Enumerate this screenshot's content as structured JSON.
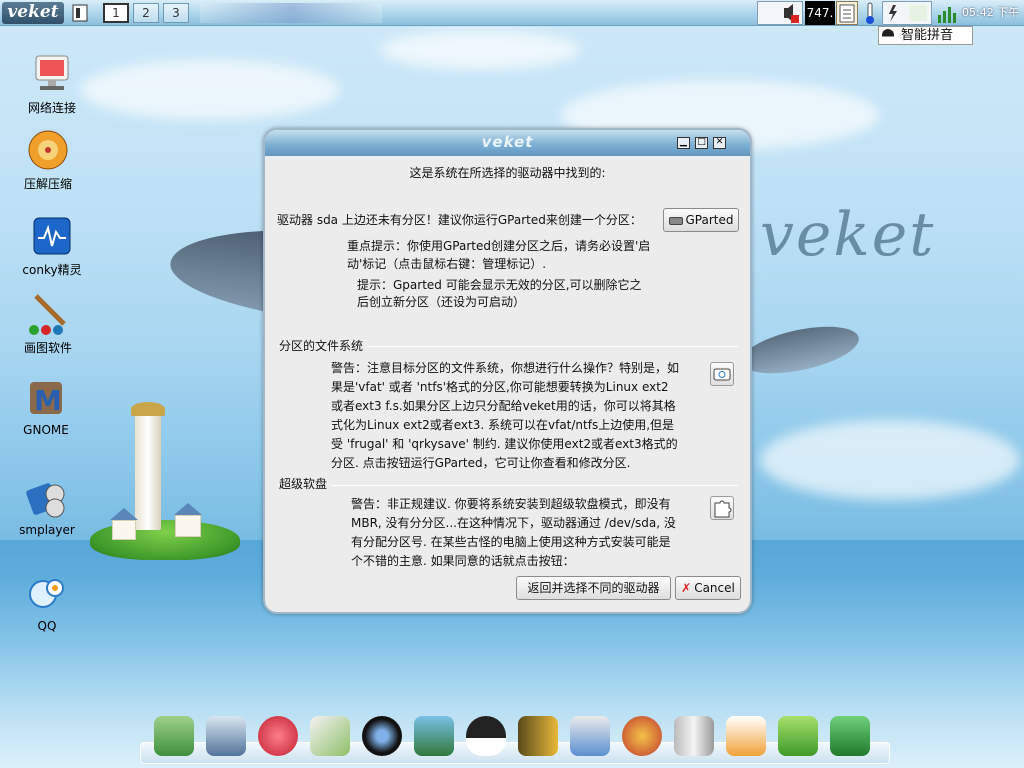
{
  "topbar": {
    "logo": "veket",
    "workspaces": [
      "1",
      "2",
      "3"
    ],
    "active_workspace": "1",
    "cpu_meter": "747.",
    "clock": "05:42 下午"
  },
  "ime": {
    "label": "智能拼音"
  },
  "desktop": {
    "icons": [
      {
        "label": "网络连接",
        "icon": "network-icon"
      },
      {
        "label": "压解压缩",
        "icon": "archive-icon"
      },
      {
        "label": "conky精灵",
        "icon": "monitor-icon"
      },
      {
        "label": "画图软件",
        "icon": "paint-icon"
      },
      {
        "label": "GNOME",
        "icon": "gnome-icon"
      },
      {
        "label": "smplayer",
        "icon": "media-player-icon"
      },
      {
        "label": "QQ",
        "icon": "qq-icon"
      }
    ]
  },
  "wallpaper": {
    "watermark": "veket"
  },
  "dialog": {
    "title": "veket",
    "found_heading": "这是系统在所选择的驱动器中找到的:",
    "no_partition_msg": "驱动器 sda 上边还未有分区！建议你运行GParted来创建一个分区：",
    "gparted_button": "GParted",
    "tip1_line1": "重点提示：你使用GParted创建分区之后，请务必设置'启",
    "tip1_line2": "动'标记（点击鼠标右键：管理标记）.",
    "tip2_line1": "提示：Gparted 可能会显示无效的分区,可以删除它之",
    "tip2_line2": "后创立新分区（还设为可启动）",
    "fs_section_title": "分区的文件系统",
    "fs_warning_lines": [
      "警告：注意目标分区的文件系统，你想进行什么操作？特别是，如",
      "果是'vfat' 或者 'ntfs'格式的分区,你可能想要转换为Linux ext2",
      "或者ext3 f.s.如果分区上边只分配给veket用的话，你可以将其格",
      "式化为Linux ext2或者ext3. 系统可以在vfat/ntfs上边使用,但是",
      "受 'frugal' 和 'qrkysave' 制约. 建议你使用ext2或者ext3格式的",
      "分区. 点击按钮运行GParted，它可让你查看和修改分区."
    ],
    "floppy_section_title": "超级软盘",
    "floppy_warning_lines": [
      "警告：非正规建议. 你要将系统安装到超级软盘模式，即没有",
      "MBR, 没有分分区...在这种情况下，驱动器通过 /dev/sda, 没",
      "有分配分区号. 在某些古怪的电脑上使用这种方式安装可能是",
      "个不错的主意. 如果同意的话就点击按钮："
    ],
    "back_button": "返回并选择不同的驱动器",
    "cancel_button": "Cancel"
  },
  "dock": {
    "items": [
      "file-manager-icon",
      "display-icon",
      "hedgehog-icon",
      "editor-icon",
      "media-icon",
      "contacts-icon",
      "penguin-icon",
      "book-icon",
      "chart-icon",
      "paint-palette-icon",
      "usb-drive-icon",
      "dice-icon",
      "help-icon",
      "camera-icon"
    ]
  }
}
